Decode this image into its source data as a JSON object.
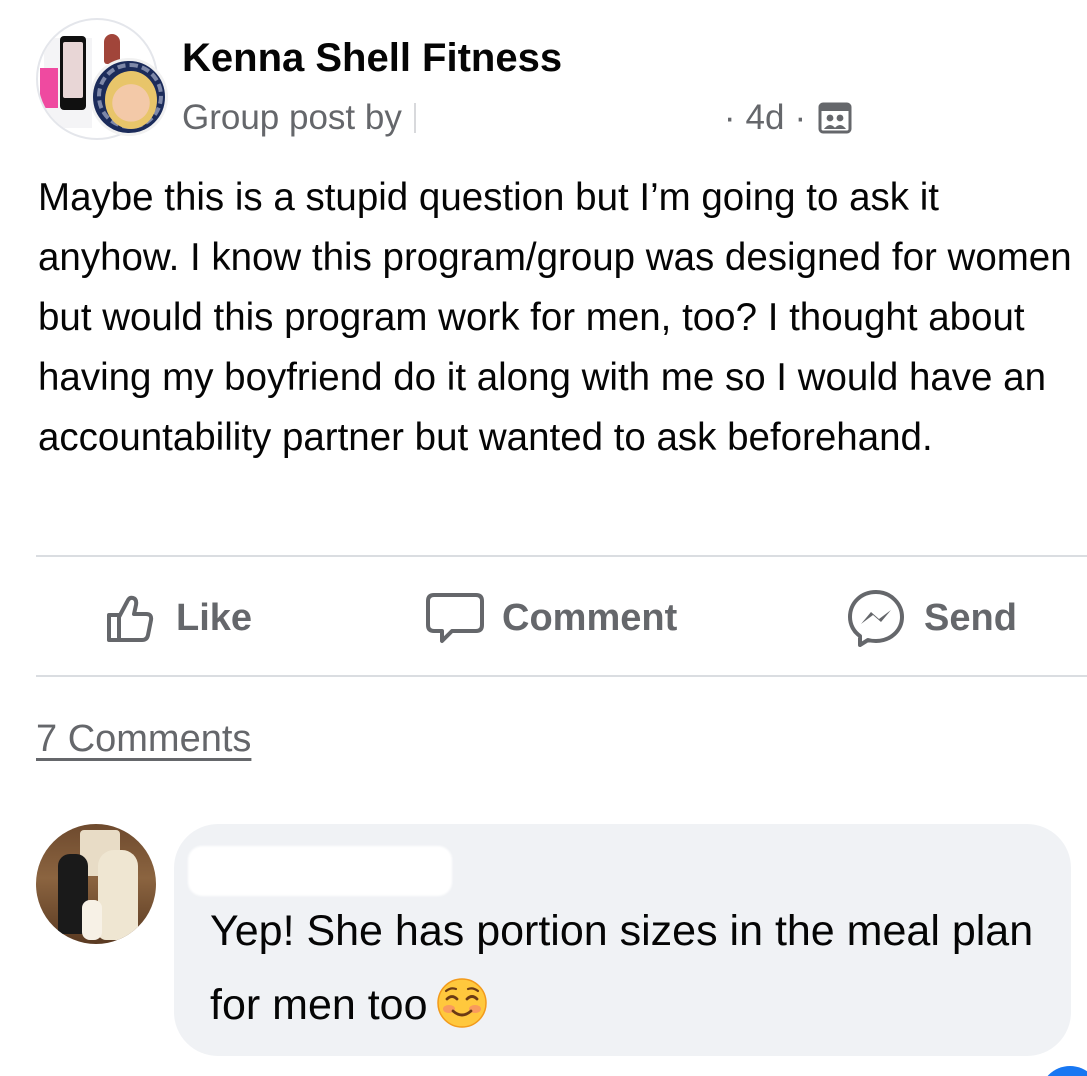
{
  "post": {
    "group_name": "Kenna Shell Fitness",
    "subline_prefix": "Group post by",
    "time_ago": "4d",
    "separator": "·",
    "audience_icon": "members-icon",
    "body": "Maybe this is a stupid question but I’m going to ask it anyhow. I know this program/group was designed for women but would this program work for men, too? I thought about having my boyfriend do it along with me so I would have an accountability partner but wanted to ask beforehand."
  },
  "actions": {
    "like_label": "Like",
    "comment_label": "Comment",
    "send_label": "Send",
    "like_icon": "thumbs-up-icon",
    "comment_icon": "speech-bubble-icon",
    "send_icon": "messenger-icon"
  },
  "comments": {
    "count_label": "7 Comments",
    "items": [
      {
        "text": "Yep! She has portion sizes in the meal plan for men too",
        "emoji": "smiling-face-icon"
      }
    ]
  },
  "colors": {
    "text_primary": "#050505",
    "text_secondary": "#65676b",
    "divider": "#dadde1",
    "bubble_bg": "#f0f2f5",
    "accent": "#1877f2"
  }
}
